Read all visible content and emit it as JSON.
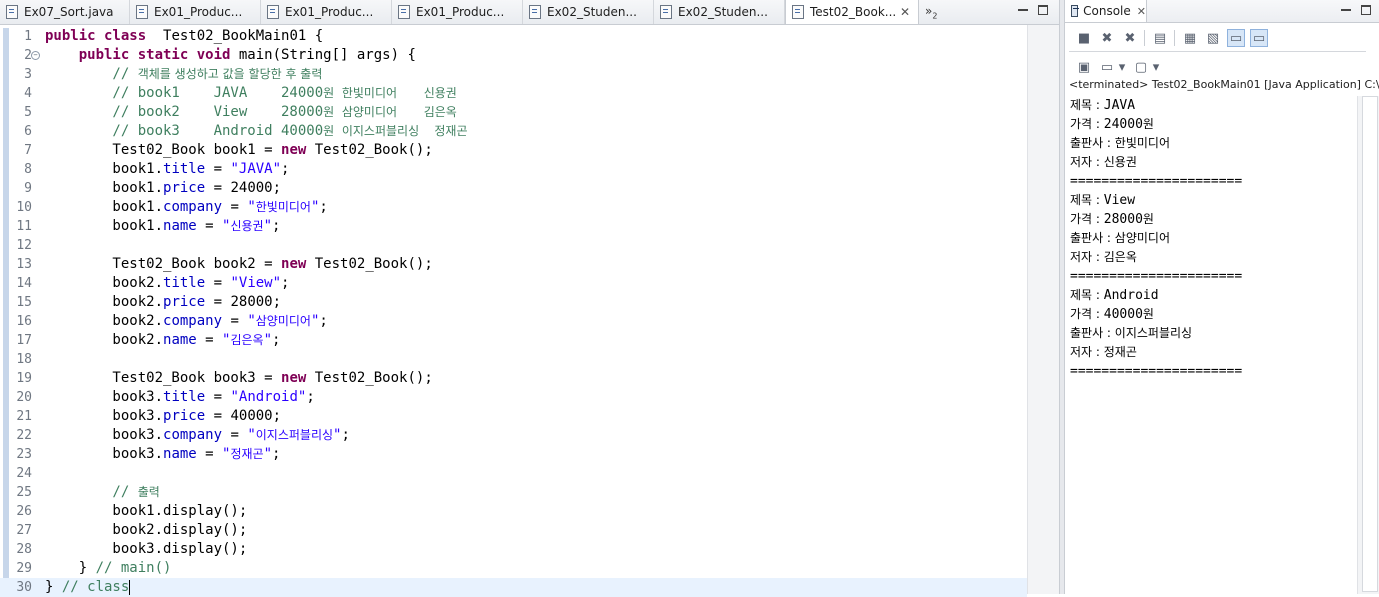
{
  "editor": {
    "tabs": [
      {
        "label": "Ex07_Sort.java",
        "active": false
      },
      {
        "label": "Ex01_Produc...",
        "active": false
      },
      {
        "label": "Ex01_Produc...",
        "active": false
      },
      {
        "label": "Ex01_Produc...",
        "active": false
      },
      {
        "label": "Ex02_Studen...",
        "active": false
      },
      {
        "label": "Ex02_Studen...",
        "active": false
      },
      {
        "label": "Test02_Book...",
        "active": true
      }
    ],
    "overflow_label": "»",
    "overflow_count": "2",
    "close_glyph": "✕",
    "lines": [
      {
        "n": "1",
        "segs": [
          [
            "kw",
            "public class"
          ],
          [
            "",
            "  Test02_BookMain01 {"
          ]
        ]
      },
      {
        "n": "2",
        "fold": "−",
        "segs": [
          [
            "",
            "    "
          ],
          [
            "kw",
            "public static void"
          ],
          [
            "",
            " main(String[] args) {"
          ]
        ]
      },
      {
        "n": "3",
        "segs": [
          [
            "cmt",
            "        // "
          ],
          [
            "cmt kr",
            "객체를 생성하고 값을 할당한 후 출력"
          ]
        ]
      },
      {
        "n": "4",
        "segs": [
          [
            "cmt",
            "        // book1    JAVA    24000"
          ],
          [
            "cmt kr",
            "원  한빛미디어       신용권"
          ]
        ]
      },
      {
        "n": "5",
        "segs": [
          [
            "cmt",
            "        // book2    View    28000"
          ],
          [
            "cmt kr",
            "원  삼양미디어       김은옥"
          ]
        ]
      },
      {
        "n": "6",
        "segs": [
          [
            "cmt",
            "        // book3    Android 40000"
          ],
          [
            "cmt kr",
            "원  이지스퍼블리싱    정재곤"
          ]
        ]
      },
      {
        "n": "7",
        "segs": [
          [
            "",
            "        Test02_Book book1 = "
          ],
          [
            "kw",
            "new"
          ],
          [
            "",
            " Test02_Book();"
          ]
        ]
      },
      {
        "n": "8",
        "segs": [
          [
            "",
            "        book1."
          ],
          [
            "field",
            "title"
          ],
          [
            "",
            " = "
          ],
          [
            "str",
            "\"JAVA\""
          ],
          [
            "",
            ";"
          ]
        ]
      },
      {
        "n": "9",
        "segs": [
          [
            "",
            "        book1."
          ],
          [
            "field",
            "price"
          ],
          [
            "",
            " = 24000;"
          ]
        ]
      },
      {
        "n": "10",
        "segs": [
          [
            "",
            "        book1."
          ],
          [
            "field",
            "company"
          ],
          [
            "",
            " = "
          ],
          [
            "str",
            "\""
          ],
          [
            "str kr",
            "한빛미디어"
          ],
          [
            "str",
            "\""
          ],
          [
            "",
            ";"
          ]
        ]
      },
      {
        "n": "11",
        "segs": [
          [
            "",
            "        book1."
          ],
          [
            "field",
            "name"
          ],
          [
            "",
            " = "
          ],
          [
            "str",
            "\""
          ],
          [
            "str kr",
            "신용권"
          ],
          [
            "str",
            "\""
          ],
          [
            "",
            ";"
          ]
        ]
      },
      {
        "n": "12",
        "segs": []
      },
      {
        "n": "13",
        "segs": [
          [
            "",
            "        Test02_Book book2 = "
          ],
          [
            "kw",
            "new"
          ],
          [
            "",
            " Test02_Book();"
          ]
        ]
      },
      {
        "n": "14",
        "segs": [
          [
            "",
            "        book2."
          ],
          [
            "field",
            "title"
          ],
          [
            "",
            " = "
          ],
          [
            "str",
            "\"View\""
          ],
          [
            "",
            ";"
          ]
        ]
      },
      {
        "n": "15",
        "segs": [
          [
            "",
            "        book2."
          ],
          [
            "field",
            "price"
          ],
          [
            "",
            " = 28000;"
          ]
        ]
      },
      {
        "n": "16",
        "segs": [
          [
            "",
            "        book2."
          ],
          [
            "field",
            "company"
          ],
          [
            "",
            " = "
          ],
          [
            "str",
            "\""
          ],
          [
            "str kr",
            "삼양미디어"
          ],
          [
            "str",
            "\""
          ],
          [
            "",
            ";"
          ]
        ]
      },
      {
        "n": "17",
        "segs": [
          [
            "",
            "        book2."
          ],
          [
            "field",
            "name"
          ],
          [
            "",
            " = "
          ],
          [
            "str",
            "\""
          ],
          [
            "str kr",
            "김은옥"
          ],
          [
            "str",
            "\""
          ],
          [
            "",
            ";"
          ]
        ]
      },
      {
        "n": "18",
        "segs": []
      },
      {
        "n": "19",
        "segs": [
          [
            "",
            "        Test02_Book book3 = "
          ],
          [
            "kw",
            "new"
          ],
          [
            "",
            " Test02_Book();"
          ]
        ]
      },
      {
        "n": "20",
        "segs": [
          [
            "",
            "        book3."
          ],
          [
            "field",
            "title"
          ],
          [
            "",
            " = "
          ],
          [
            "str",
            "\"Android\""
          ],
          [
            "",
            ";"
          ]
        ]
      },
      {
        "n": "21",
        "segs": [
          [
            "",
            "        book3."
          ],
          [
            "field",
            "price"
          ],
          [
            "",
            " = 40000;"
          ]
        ]
      },
      {
        "n": "22",
        "segs": [
          [
            "",
            "        book3."
          ],
          [
            "field",
            "company"
          ],
          [
            "",
            " = "
          ],
          [
            "str",
            "\""
          ],
          [
            "str kr",
            "이지스퍼블리싱"
          ],
          [
            "str",
            "\""
          ],
          [
            "",
            ";"
          ]
        ]
      },
      {
        "n": "23",
        "segs": [
          [
            "",
            "        book3."
          ],
          [
            "field",
            "name"
          ],
          [
            "",
            " = "
          ],
          [
            "str",
            "\""
          ],
          [
            "str kr",
            "정재곤"
          ],
          [
            "str",
            "\""
          ],
          [
            "",
            ";"
          ]
        ]
      },
      {
        "n": "24",
        "segs": []
      },
      {
        "n": "25",
        "segs": [
          [
            "cmt",
            "        // "
          ],
          [
            "cmt kr",
            "출력"
          ]
        ]
      },
      {
        "n": "26",
        "segs": [
          [
            "",
            "        book1.display();"
          ]
        ]
      },
      {
        "n": "27",
        "segs": [
          [
            "",
            "        book2.display();"
          ]
        ]
      },
      {
        "n": "28",
        "segs": [
          [
            "",
            "        book3.display();"
          ]
        ]
      },
      {
        "n": "29",
        "segs": [
          [
            "",
            "    } "
          ],
          [
            "cmt",
            "// main()"
          ]
        ]
      },
      {
        "n": "30",
        "current": true,
        "segs": [
          [
            "",
            "} "
          ],
          [
            "cmt",
            "// class"
          ]
        ]
      }
    ]
  },
  "console": {
    "tab_label": "Console",
    "close_glyph": "✕",
    "toolbar1_icons": [
      "terminate-icon",
      "remove-launch-icon",
      "remove-all-terminated-icon",
      "clear-console-icon",
      "scroll-lock-icon",
      "word-wrap-icon",
      "show-stdout-icon",
      "show-stderr-icon"
    ],
    "toolbar1_glyphs": [
      "■",
      "✖",
      "✖",
      "▤",
      "▦",
      "▧",
      "▭",
      "▭"
    ],
    "toolbar2_icons": [
      "pin-console-icon",
      "display-selected-console-icon",
      "open-console-icon"
    ],
    "toolbar2_glyphs": [
      "▣",
      "▭",
      "▢"
    ],
    "dropdown_glyph": "▾",
    "status": "<terminated> Test02_BookMain01 [Java Application] C:\\",
    "output": [
      [
        [
          "kr",
          "제목 : "
        ],
        [
          "",
          "JAVA"
        ]
      ],
      [
        [
          "kr",
          "가격 : "
        ],
        [
          "",
          "24000"
        ],
        [
          "kr",
          "원"
        ]
      ],
      [
        [
          "kr",
          "출판사 : 한빛미디어"
        ]
      ],
      [
        [
          "kr",
          "저자 : 신용권"
        ]
      ],
      [
        [
          "",
          "======================"
        ]
      ],
      [
        [
          "kr",
          "제목 : "
        ],
        [
          "",
          "View"
        ]
      ],
      [
        [
          "kr",
          "가격 : "
        ],
        [
          "",
          "28000"
        ],
        [
          "kr",
          "원"
        ]
      ],
      [
        [
          "kr",
          "출판사 : 삼양미디어"
        ]
      ],
      [
        [
          "kr",
          "저자 : 김은옥"
        ]
      ],
      [
        [
          "",
          "======================"
        ]
      ],
      [
        [
          "kr",
          "제목 : "
        ],
        [
          "",
          "Android"
        ]
      ],
      [
        [
          "kr",
          "가격 : "
        ],
        [
          "",
          "40000"
        ],
        [
          "kr",
          "원"
        ]
      ],
      [
        [
          "kr",
          "출판사 : 이지스퍼블리싱"
        ]
      ],
      [
        [
          "kr",
          "저자 : 정재곤"
        ]
      ],
      [
        [
          "",
          "======================"
        ]
      ]
    ]
  }
}
